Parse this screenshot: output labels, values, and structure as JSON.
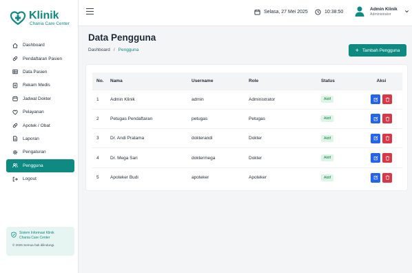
{
  "app": {
    "name": "Klinik",
    "subtitle": "Chania Care Center"
  },
  "sidebar": {
    "items": [
      {
        "label": "Dashboard",
        "icon": "home-icon",
        "active": false
      },
      {
        "label": "Pendaftaran Pasien",
        "icon": "pill-icon",
        "active": false
      },
      {
        "label": "Data Pasien",
        "icon": "table-icon",
        "active": false
      },
      {
        "label": "Rekam Medis",
        "icon": "medical-record-icon",
        "active": false
      },
      {
        "label": "Jadwal Dokter",
        "icon": "calendar-icon",
        "active": false
      },
      {
        "label": "Pelayanan",
        "icon": "heart-icon",
        "active": false
      },
      {
        "label": "Apotek / Obat",
        "icon": "pill-icon",
        "active": false
      },
      {
        "label": "Laporan",
        "icon": "document-icon",
        "active": false
      },
      {
        "label": "Pengaturan",
        "icon": "gear-icon",
        "active": false
      },
      {
        "label": "Pengguna",
        "icon": "users-icon",
        "active": true
      },
      {
        "label": "Logout",
        "icon": "logout-icon",
        "active": false
      }
    ],
    "info_card": {
      "line1": "Sistem Informasi Klinik",
      "line2": "Chania Care Center",
      "copyright": "© 2025 Semua hak dilindungi."
    }
  },
  "topbar": {
    "date": "Selasa, 27 Mei 2025",
    "time": "10:38:50",
    "user_name": "Admin Klinik",
    "user_role": "Administrator"
  },
  "page": {
    "title": "Data Pengguna",
    "breadcrumb": {
      "parent": "Dashboard",
      "separator": "/",
      "current": "Pengguna"
    },
    "add_button_label": "Tambah Pengguna"
  },
  "table": {
    "headers": {
      "no": "No.",
      "nama": "Nama",
      "username": "Username",
      "role": "Role",
      "status": "Status",
      "aksi": "Aksi"
    },
    "rows": [
      {
        "no": "1",
        "nama": "Admin Klinik",
        "username": "admin",
        "role": "Administrator",
        "status": "Aktif"
      },
      {
        "no": "2",
        "nama": "Petugas Pendaftaran",
        "username": "petugas",
        "role": "Petugas",
        "status": "Aktif"
      },
      {
        "no": "3",
        "nama": "Dr. Andi Pratama",
        "username": "dokterandi",
        "role": "Dokter",
        "status": "Aktif"
      },
      {
        "no": "4",
        "nama": "Dr. Mega Sari",
        "username": "doktermega",
        "role": "Dokter",
        "status": "Aktif"
      },
      {
        "no": "5",
        "nama": "Apoteker Budi",
        "username": "apoteker",
        "role": "Apoteker",
        "status": "Aktif"
      }
    ]
  },
  "colors": {
    "primary": "#0f8a82",
    "edit": "#2563eb",
    "delete": "#dc3545",
    "badge_bg": "#dcf5e6",
    "badge_text": "#15803d"
  }
}
